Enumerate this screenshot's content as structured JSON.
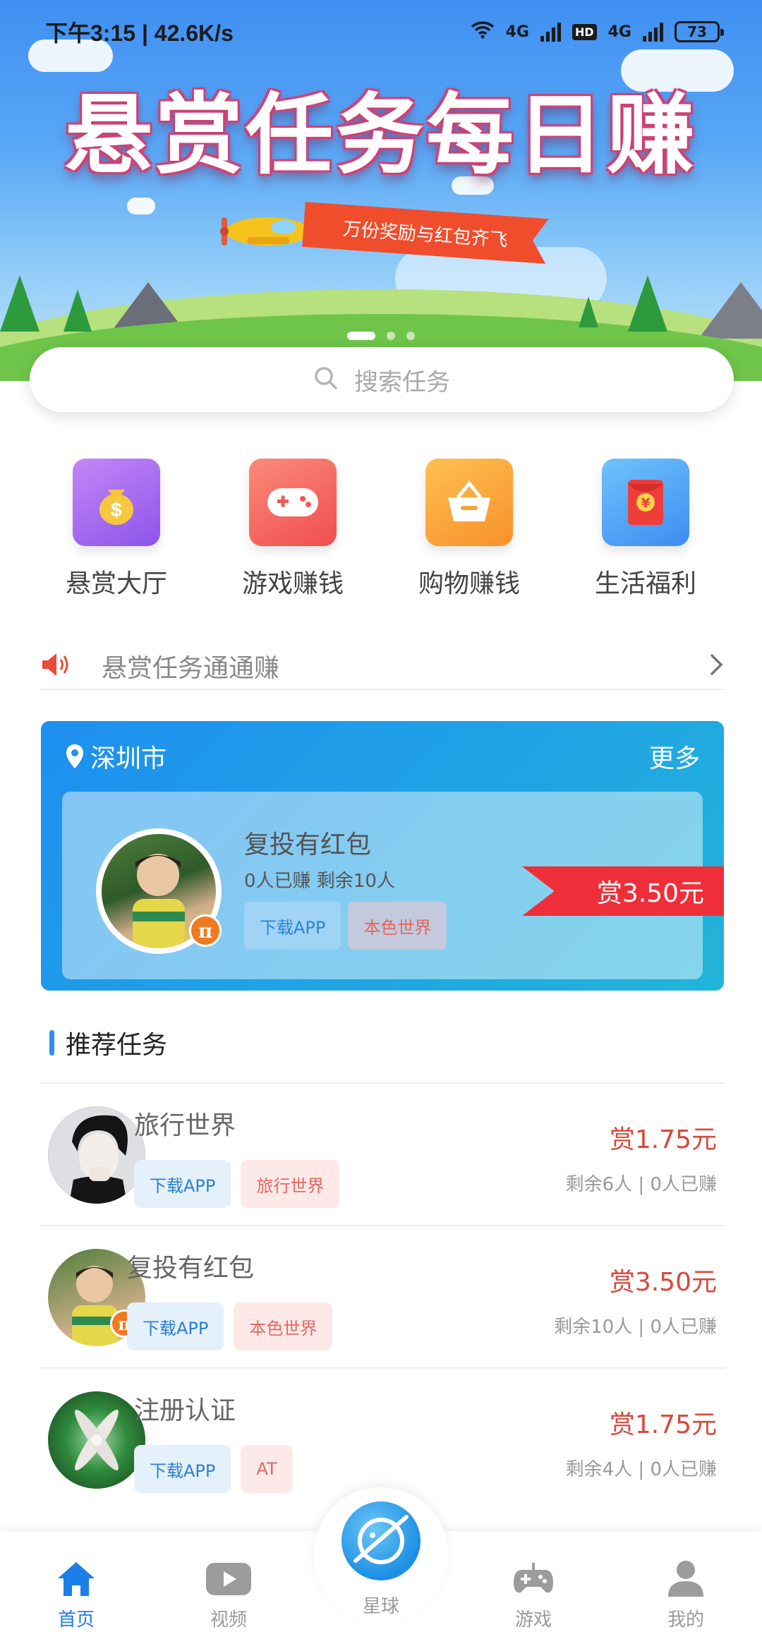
{
  "status_bar": {
    "time_speed": "下午3:15 | 42.6K/s",
    "net1": "4G",
    "hd": "HD",
    "net2": "4G",
    "battery": "73"
  },
  "banner": {
    "headline": "悬赏任务每日赚",
    "ribbon": "万份奖励与红包齐飞",
    "slides": 3,
    "active_slide": 0
  },
  "search": {
    "placeholder": "搜索任务"
  },
  "categories": [
    {
      "label": "悬赏大厅",
      "icon": "money-bag-icon",
      "color": "#a46bf3"
    },
    {
      "label": "游戏赚钱",
      "icon": "gamepad-icon",
      "color": "#f4625f"
    },
    {
      "label": "购物赚钱",
      "icon": "shopping-basket-icon",
      "color": "#f6a43a"
    },
    {
      "label": "生活福利",
      "icon": "red-envelope-icon",
      "color": "#4aa0f5"
    }
  ],
  "notice": {
    "text": "悬赏任务通通赚"
  },
  "city_card": {
    "city": "深圳市",
    "more": "更多",
    "title": "复投有红包",
    "stats": "0人已赚   剩余10人",
    "tags": [
      "下载APP",
      "本色世界"
    ],
    "reward": "赏3.50元",
    "badge": "π"
  },
  "section": {
    "title": "推荐任务"
  },
  "tasks": [
    {
      "title": "旅行世界",
      "tags": [
        "下载APP",
        "旅行世界"
      ],
      "reward": "赏1.75元",
      "meta": "剩余6人 | 0人已赚"
    },
    {
      "title": "复投有红包",
      "tags": [
        "下载APP",
        "本色世界"
      ],
      "reward": "赏3.50元",
      "meta": "剩余10人 | 0人已赚"
    },
    {
      "title": "注册认证",
      "tags": [
        "下载APP",
        "AT"
      ],
      "reward": "赏1.75元",
      "meta": "剩余4人 | 0人已赚"
    }
  ],
  "nav": {
    "home": "首页",
    "video": "视频",
    "planet": "星球",
    "game": "游戏",
    "mine": "我的",
    "active": "home"
  },
  "colors": {
    "accent": "#1c7ee8",
    "reward": "#d9483c",
    "flag": "#ee2f3a"
  }
}
